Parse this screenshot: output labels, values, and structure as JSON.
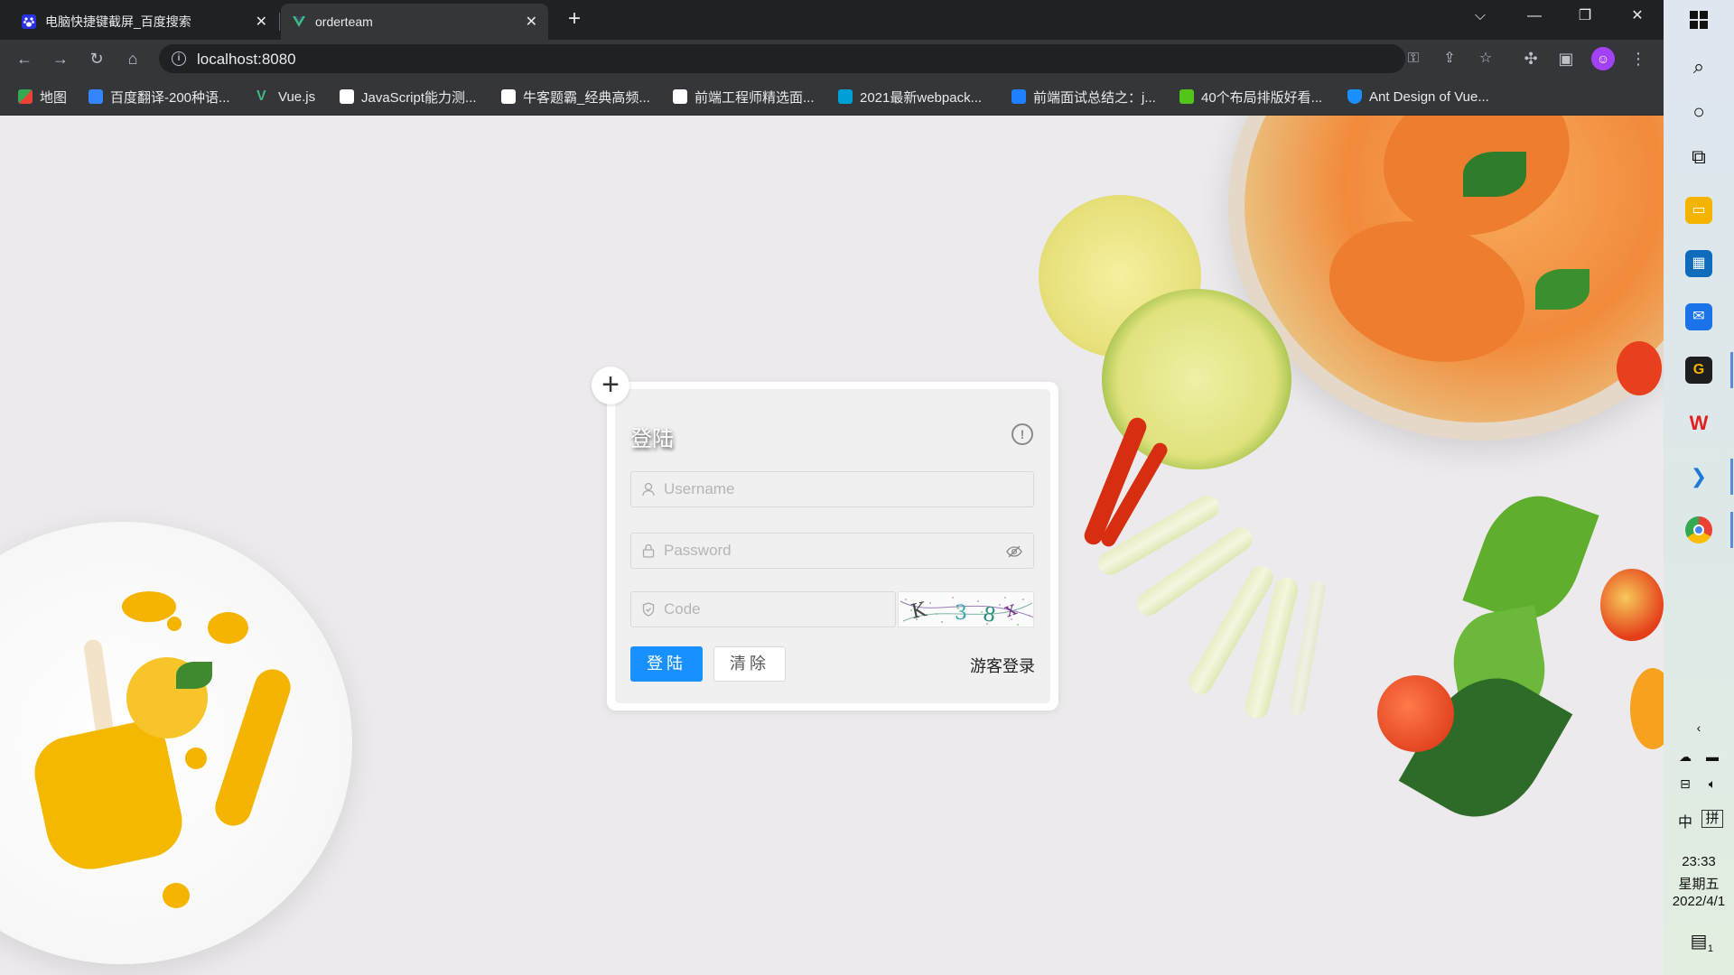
{
  "browser": {
    "tabs": [
      {
        "title": "电脑快捷键截屏_百度搜索",
        "icon": "baidu-paw-icon",
        "active": false
      },
      {
        "title": "orderteam",
        "icon": "vue-logo-icon",
        "active": true
      }
    ],
    "url": "localhost:8080",
    "bookmarks": [
      {
        "label": "地图",
        "icon": "maps-icon",
        "color": "#34a853"
      },
      {
        "label": "百度翻译-200种语...",
        "icon": "baidu-translate-icon",
        "color": "#3385ff"
      },
      {
        "label": "Vue.js",
        "icon": "vue-logo-icon",
        "color": "#41b883"
      },
      {
        "label": "JavaScript能力测...",
        "icon": "nowcoder-icon",
        "color": "#ffffff"
      },
      {
        "label": "牛客题霸_经典高频...",
        "icon": "nowcoder-icon",
        "color": "#ffffff"
      },
      {
        "label": "前端工程师精选面...",
        "icon": "nowcoder-icon",
        "color": "#ffffff"
      },
      {
        "label": "2021最新webpack...",
        "icon": "bilibili-tv-icon",
        "color": "#00a1d6"
      },
      {
        "label": "前端面试总结之：j...",
        "icon": "juejin-icon",
        "color": "#1e80ff"
      },
      {
        "label": "40个布局排版好看...",
        "icon": "green-doc-icon",
        "color": "#52c41a"
      },
      {
        "label": "Ant Design of Vue...",
        "icon": "antd-shield-icon",
        "color": "#1890ff"
      }
    ]
  },
  "login": {
    "title": "登陆",
    "username_placeholder": "Username",
    "password_placeholder": "Password",
    "code_placeholder": "Code",
    "login_label": "登陆",
    "clear_label": "清除",
    "guest_label": "游客登录"
  },
  "taskbar": {
    "ime_lang": "中",
    "ime_mode": "拼",
    "time": "23:33",
    "weekday": "星期五",
    "date": "2022/4/1",
    "notification_count": "1"
  },
  "colors": {
    "primary": "#1890ff",
    "chrome_dark": "#202124",
    "chrome_toolbar": "#35363a"
  }
}
